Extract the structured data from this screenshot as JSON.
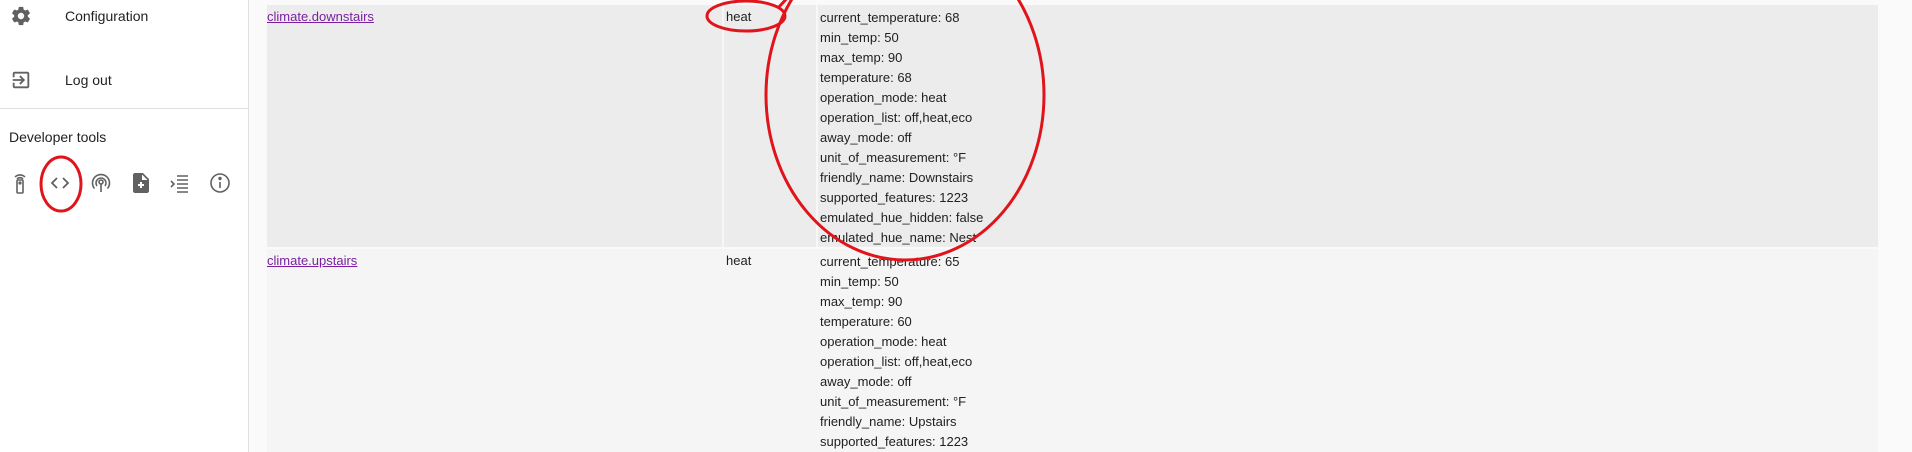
{
  "sidebar": {
    "menu": [
      {
        "label": "Configuration",
        "icon": "gear-icon"
      },
      {
        "label": "Log out",
        "icon": "logout-icon"
      }
    ],
    "developer_tools": {
      "title": "Developer tools",
      "icons": [
        "remote-icon",
        "code-icon",
        "broadcast-icon",
        "file-icon",
        "log-icon",
        "info-icon"
      ]
    }
  },
  "entities": [
    {
      "entity_id": "climate.downstairs",
      "state": "heat",
      "attributes": [
        "current_temperature: 68",
        "min_temp: 50",
        "max_temp: 90",
        "temperature: 68",
        "operation_mode: heat",
        "operation_list: off,heat,eco",
        "away_mode: off",
        "unit_of_measurement: °F",
        "friendly_name: Downstairs",
        "supported_features: 1223",
        "emulated_hue_hidden: false",
        "emulated_hue_name: Nest"
      ]
    },
    {
      "entity_id": "climate.upstairs",
      "state": "heat",
      "attributes": [
        "current_temperature: 65",
        "min_temp: 50",
        "max_temp: 90",
        "temperature: 60",
        "operation_mode: heat",
        "operation_list: off,heat,eco",
        "away_mode: off",
        "unit_of_measurement: °F",
        "friendly_name: Upstairs",
        "supported_features: 1223"
      ]
    }
  ],
  "colors": {
    "link": "#7b1fa2",
    "annotation": "#e0151b",
    "icon": "#616161"
  }
}
